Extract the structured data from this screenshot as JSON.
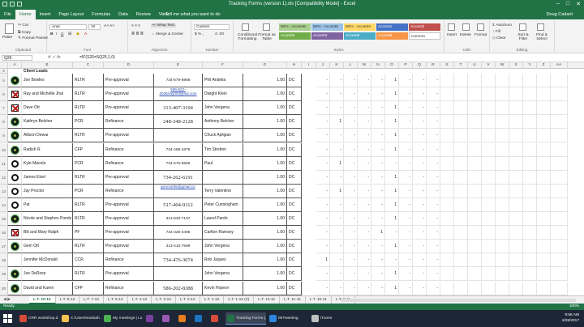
{
  "window": {
    "title": "Tracking Forms (version 1).xls  [Compatibility Mode]  -  Excel",
    "user": "Doug Cadarit"
  },
  "tabs": [
    "File",
    "Home",
    "Insert",
    "Page Layout",
    "Formulas",
    "Data",
    "Review",
    "View"
  ],
  "tell_me": "Tell me what you want to do",
  "ribbon": {
    "clipboard": {
      "paste": "Paste",
      "cut": "Cut",
      "copy": "Copy",
      "format_painter": "Format Painter",
      "group": "Clipboard"
    },
    "font": {
      "name": "Arial",
      "size": "10",
      "group": "Font"
    },
    "alignment": {
      "wrap": "Wrap Text",
      "merge": "Merge & Center",
      "group": "Alignment"
    },
    "number": {
      "format": "Custom",
      "group": "Number"
    },
    "styles": {
      "conditional": "Conditional Formatting",
      "format_table": "Format as Table",
      "cells": [
        {
          "label": "60% - Accent6",
          "bg": "#a9d08e"
        },
        {
          "label": "60% - Accent5",
          "bg": "#9bc2e6"
        },
        {
          "label": "60% - Accent4",
          "bg": "#ffd966"
        },
        {
          "label": "Accent1",
          "bg": "#4472c4"
        },
        {
          "label": "Accent2",
          "bg": "#c0504d"
        },
        {
          "label": "Accent3",
          "bg": "#70ad47"
        },
        {
          "label": "Accent4",
          "bg": "#8064a2"
        },
        {
          "label": "Accent5",
          "bg": "#4bacc6"
        },
        {
          "label": "Accent6",
          "bg": "#f79646"
        },
        {
          "label": "Comma",
          "bg": "#ffffff"
        }
      ],
      "group": "Styles"
    },
    "cells": {
      "insert": "Insert",
      "delete": "Delete",
      "format": "Format",
      "group": "Cells"
    },
    "editing": {
      "autosum": "AutoSum",
      "fill": "Fill",
      "clear": "Clear",
      "sort": "Sort & Filter",
      "find": "Find & Select",
      "group": "Editing"
    }
  },
  "formula_bar": {
    "name_box": "Q26",
    "formula": "=IF(S26=SQ25,1,0)"
  },
  "columns": [
    "A",
    "B",
    "C",
    "D",
    "E",
    "F",
    "G",
    "H",
    "I",
    "J",
    "K",
    "L",
    "M",
    "N",
    "O",
    "P",
    "Q",
    "R",
    "S",
    "T",
    "U",
    "V",
    "W",
    "X",
    "Y",
    "Z",
    "AA"
  ],
  "header_row": {
    "num": "4",
    "text": "Client Leads"
  },
  "rows": [
    {
      "num": "5",
      "icon": "lucky",
      "name": "Joe Bowles",
      "type": "RLTR",
      "status": "Pre-approval",
      "phone": "734-679-6968",
      "phone_style": "small",
      "agent": "Phil Andelia",
      "n": "1.00",
      "st": "DC",
      "flags": [
        0,
        0,
        0,
        0,
        0,
        1,
        0
      ]
    },
    {
      "num": "6",
      "icon": "x",
      "name": "Ray and Michelle Jhal",
      "type": "RLTR",
      "status": "Pre-approval",
      "phone": "586-822-3036/raymhl@aol.com",
      "phone_style": "link",
      "agent": "Dwight Klein",
      "n": "1.00",
      "st": "DC",
      "flags": [
        0,
        0,
        0,
        0,
        0,
        1,
        0
      ]
    },
    {
      "num": "7",
      "icon": "x",
      "name": "Dave Ott",
      "type": "RLTR",
      "status": "Pre-approval",
      "phone": "313-407-3194",
      "phone_style": "big",
      "agent": "John Vergena",
      "n": "1.00",
      "st": "DC",
      "flags": [
        0,
        0,
        0,
        0,
        0,
        1,
        0
      ]
    },
    {
      "num": "8",
      "icon": "lucky",
      "name": "Kathryn Belcher",
      "type": "PCR",
      "status": "Refinance",
      "phone": "248-348-2128",
      "phone_style": "big",
      "agent": "Anthony Belcher",
      "n": "1.00",
      "st": "DC",
      "flags": [
        0,
        1,
        0,
        0,
        0,
        1,
        0
      ]
    },
    {
      "num": "9",
      "icon": "lucky",
      "name": "Allison Dewar",
      "type": "RLTR",
      "status": "Pre-approval",
      "phone": "",
      "phone_style": "small",
      "agent": "Chuck Apligian",
      "n": "1.00",
      "st": "DC",
      "flags": [
        0,
        0,
        0,
        0,
        0,
        1,
        0
      ]
    },
    {
      "num": "10",
      "icon": "lucky",
      "name": "Radish R",
      "type": "CFP",
      "status": "Refinance",
      "phone": "734-468-1878",
      "phone_style": "small",
      "agent": "Tim Stretton",
      "n": "1.00",
      "st": "DC",
      "flags": [
        0,
        0,
        0,
        0,
        0,
        1,
        0
      ]
    },
    {
      "num": "11",
      "icon": "ring",
      "name": "Kyle Macola",
      "type": "PCR",
      "status": "Refinance",
      "phone": "734-576-5565",
      "phone_style": "small",
      "agent": "Paul",
      "n": "1.00",
      "st": "DC",
      "flags": [
        0,
        1,
        0,
        0,
        0,
        0,
        0
      ]
    },
    {
      "num": "12",
      "icon": "ring",
      "name": "James Elzel",
      "type": "RLTR",
      "status": "Pre-approval",
      "phone": "734-262-6191",
      "phone_style": "big",
      "agent": "",
      "n": "1.00",
      "st": "DC",
      "flags": [
        0,
        0,
        0,
        0,
        0,
        1,
        0
      ]
    },
    {
      "num": "13",
      "icon": "ring",
      "name": "Jay Proctor",
      "type": "PCR",
      "status": "Refinance",
      "phone": "jproctor85@gmail.co",
      "phone_style": "link",
      "agent": "Terry Valentine",
      "n": "1.00",
      "st": "DC",
      "flags": [
        0,
        1,
        0,
        0,
        0,
        1,
        0
      ]
    },
    {
      "num": "14",
      "icon": "ring",
      "name": "Pat",
      "type": "RLTR",
      "status": "Pre-approval",
      "phone": "517-404-9112",
      "phone_style": "big",
      "agent": "Peter Cunningham",
      "n": "1.00",
      "st": "DC",
      "flags": [
        0,
        0,
        0,
        0,
        0,
        1,
        0
      ]
    },
    {
      "num": "15",
      "icon": "lucky",
      "name": "Nicole and Stephen Ponds",
      "type": "RLTR",
      "status": "Pre-approval",
      "phone": "313-640-7197",
      "phone_style": "small",
      "agent": "Laurel Pardo",
      "n": "1.00",
      "st": "DC",
      "flags": [
        0,
        0,
        0,
        0,
        0,
        1,
        0
      ]
    },
    {
      "num": "16",
      "icon": "x",
      "name": "Bill and Mary Ralph",
      "type": "PF",
      "status": "Pre-approval",
      "phone": "734-326-4495",
      "phone_style": "small",
      "agent": "Carlton Ramsey",
      "n": "1.00",
      "st": "DC",
      "flags": [
        0,
        0,
        0,
        0,
        1,
        0,
        0
      ]
    },
    {
      "num": "17",
      "icon": "lucky",
      "name": "Gem Ott",
      "type": "RLTR",
      "status": "Pre-approval",
      "phone": "313-410-7599",
      "phone_style": "small",
      "agent": "John Vergena",
      "n": "1.00",
      "st": "DC",
      "flags": [
        0,
        0,
        0,
        0,
        0,
        1,
        0
      ]
    },
    {
      "num": "18",
      "icon": "none",
      "name": "Jennifer McDonald",
      "type": "CCR",
      "status": "Refinance",
      "phone": "734-476-3074",
      "phone_style": "big",
      "agent": "Rob Jaques",
      "n": "1.00",
      "st": "DC",
      "flags": [
        1,
        0,
        0,
        0,
        0,
        0,
        0
      ]
    },
    {
      "num": "19",
      "icon": "lucky",
      "name": "Joe DeRose",
      "type": "RLTR",
      "status": "Pre-approval",
      "phone": "",
      "phone_style": "small",
      "agent": "John Vergena",
      "n": "1.00",
      "st": "DC",
      "flags": [
        0,
        0,
        0,
        0,
        0,
        1,
        0
      ]
    },
    {
      "num": "20",
      "icon": "lucky",
      "name": "David and Karen",
      "type": "CFP",
      "status": "Refinance",
      "phone": "586-202-8388",
      "phone_style": "big",
      "agent": "Kevin Hopeor",
      "n": "1.00",
      "st": "DC",
      "flags": [
        0,
        0,
        0,
        0,
        0,
        1,
        0
      ]
    }
  ],
  "sheet_tabs": [
    "L.T. 10-12",
    "L.T. 9-12",
    "L.T. 7-12",
    "L.T. 5-12",
    "L.T. 4-12",
    "L.T. 3-12",
    "L.T. 2-12",
    "L.T. 1-12",
    "L.T. 1-12 (2)",
    "L.T. 12-11",
    "L.T. 11-11",
    "L.T. 10-11",
    "L.T. 9-11"
  ],
  "status": {
    "ready": "Ready",
    "zoom": "100%"
  },
  "taskbar": {
    "items": [
      {
        "label": "CRR workshop.d...",
        "color": "#d64b3a",
        "open": false
      },
      {
        "label": "C:\\Users\\maloah...",
        "color": "#f2c14e",
        "open": false
      },
      {
        "label": "My meetings | Lo...",
        "color": "#4caf50",
        "open": false
      },
      {
        "label": "",
        "color": "#7b3fa0",
        "open": false
      },
      {
        "label": "",
        "color": "#9b59b6",
        "open": false
      },
      {
        "label": "",
        "color": "#e67e22",
        "open": false
      },
      {
        "label": "",
        "color": "#1e73be",
        "open": false
      },
      {
        "label": "",
        "color": "#d64b3a",
        "open": false
      },
      {
        "label": "Tracking Forms (...",
        "color": "#217346",
        "open": true
      },
      {
        "label": "IMTweeting",
        "color": "#2e86de",
        "open": false
      },
      {
        "label": "iTunes",
        "color": "#c0c0c0",
        "open": false
      }
    ],
    "time": "9:56 AM",
    "date": "4/28/2017"
  }
}
